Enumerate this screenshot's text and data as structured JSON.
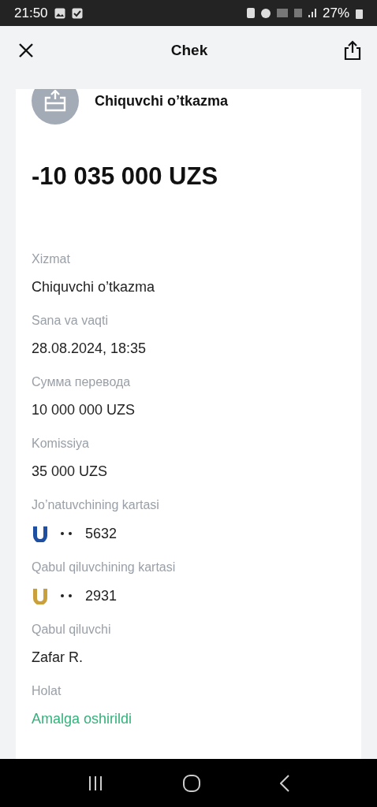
{
  "status_bar": {
    "time": "21:50",
    "battery": "27%"
  },
  "header": {
    "title": "Chek"
  },
  "transaction": {
    "title": "Chiquvchi o’tkazma",
    "amount": "-10 035 000 UZS"
  },
  "fields": [
    {
      "kind": "text",
      "label": "Xizmat",
      "value": "Chiquvchi o’tkazma"
    },
    {
      "kind": "text",
      "label": "Sana va vaqti",
      "value": "28.08.2024, 18:35"
    },
    {
      "kind": "text",
      "label": "Сумма перевода",
      "value": "10 000 000 UZS"
    },
    {
      "kind": "text",
      "label": "Komissiya",
      "value": "35 000 UZS"
    },
    {
      "kind": "card",
      "label": "Jo’natuvchining kartasi",
      "value": "5632",
      "color": "#1f4fa0"
    },
    {
      "kind": "card",
      "label": "Qabul qiluvchining kartasi",
      "value": "2931",
      "color": "#c9a03c"
    },
    {
      "kind": "text",
      "label": "Qabul qiluvchi",
      "value": "Zafar R."
    },
    {
      "kind": "status",
      "label": "Holat",
      "value": "Amalga oshirildi"
    }
  ]
}
